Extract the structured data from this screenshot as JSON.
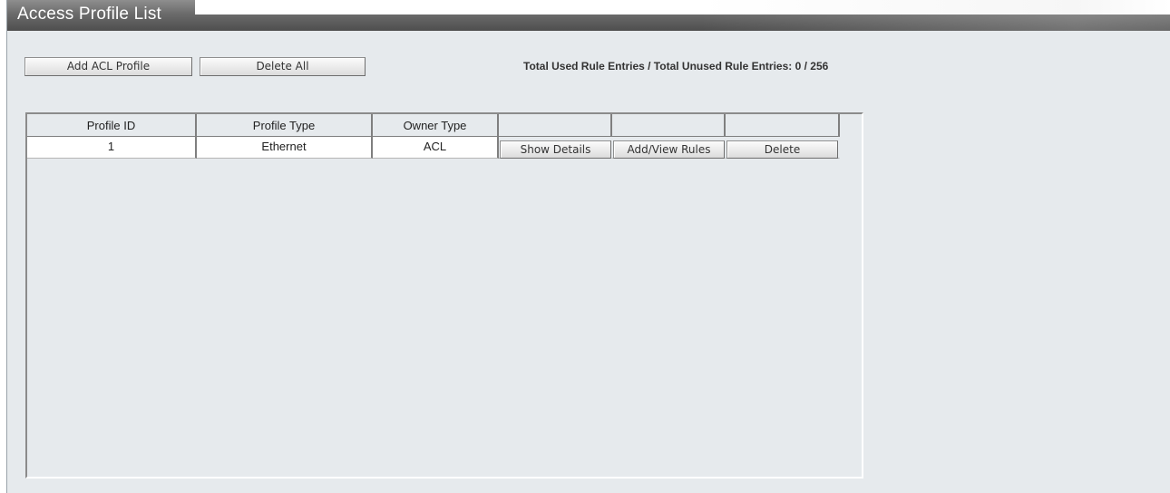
{
  "page_title": "Access Profile List",
  "toolbar": {
    "add_profile_label": "Add ACL Profile",
    "delete_all_label": "Delete All"
  },
  "summary_text": "Total Used Rule Entries / Total Unused Rule Entries: 0 / 256",
  "table": {
    "columns": [
      "Profile ID",
      "Profile Type",
      "Owner Type",
      "",
      "",
      ""
    ],
    "rows": [
      {
        "profile_id": "1",
        "profile_type": "Ethernet",
        "owner_type": "ACL",
        "show_details_label": "Show Details",
        "add_view_rules_label": "Add/View Rules",
        "delete_label": "Delete"
      }
    ]
  },
  "colors": {
    "panel_background": "#e6eaed",
    "title_bar": "#5a5a5a",
    "title_text": "#ffffff"
  }
}
